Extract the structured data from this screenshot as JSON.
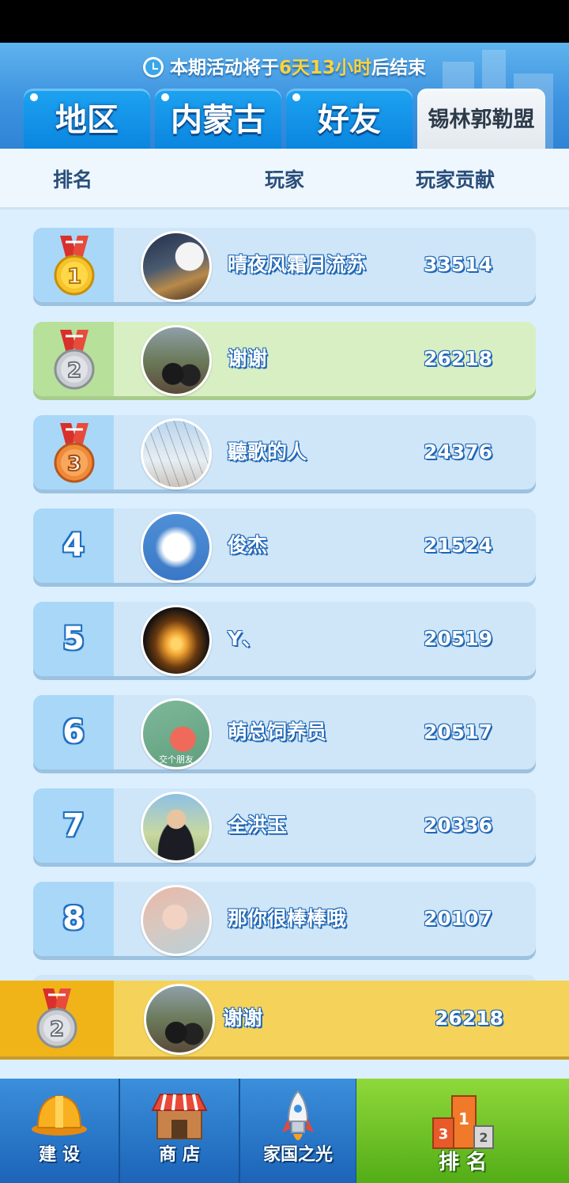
{
  "header": {
    "timer": {
      "prefix": "本期活动将于",
      "highlight": "6天13小时",
      "suffix": "后结束"
    },
    "tabs": [
      {
        "label": "地区",
        "active": false
      },
      {
        "label": "内蒙古",
        "active": false
      },
      {
        "label": "好友",
        "active": false
      },
      {
        "label": "锡林郭勒盟",
        "active": true
      }
    ]
  },
  "columns": {
    "rank": "排名",
    "player": "玩家",
    "contribution": "玩家贡献"
  },
  "rankings": [
    {
      "rank": "1",
      "name": "晴夜风霜月流苏",
      "score": "33514",
      "medal": "gold"
    },
    {
      "rank": "2",
      "name": "谢谢",
      "score": "26218",
      "medal": "silver",
      "is_me": true
    },
    {
      "rank": "3",
      "name": "聽歌的人",
      "score": "24376",
      "medal": "bronze"
    },
    {
      "rank": "4",
      "name": "俊杰",
      "score": "21524"
    },
    {
      "rank": "5",
      "name": "Y、",
      "score": "20519"
    },
    {
      "rank": "6",
      "name": "萌总饲养员",
      "score": "20517",
      "avatar_caption": "交个朋友"
    },
    {
      "rank": "7",
      "name": "全洪玉",
      "score": "20336"
    },
    {
      "rank": "8",
      "name": "那你很棒棒哦",
      "score": "20107"
    }
  ],
  "my_rank": {
    "rank": "2",
    "name": "谢谢",
    "score": "26218",
    "medal": "silver"
  },
  "nav": [
    {
      "label": "建 设",
      "icon": "hard-hat-icon",
      "active": false
    },
    {
      "label": "商 店",
      "icon": "shop-icon",
      "active": false
    },
    {
      "label": "家国之光",
      "icon": "rocket-icon",
      "active": false
    },
    {
      "label": "排 名",
      "icon": "podium-icon",
      "active": true
    }
  ],
  "colors": {
    "header_blue": "#3d93df",
    "timer_highlight": "#ffd23c",
    "gold": "#f5c32a",
    "silver": "#c9ccd1",
    "bronze": "#f08a3a",
    "my_row": "#f5d35a",
    "nav_active": "#6cc226"
  }
}
